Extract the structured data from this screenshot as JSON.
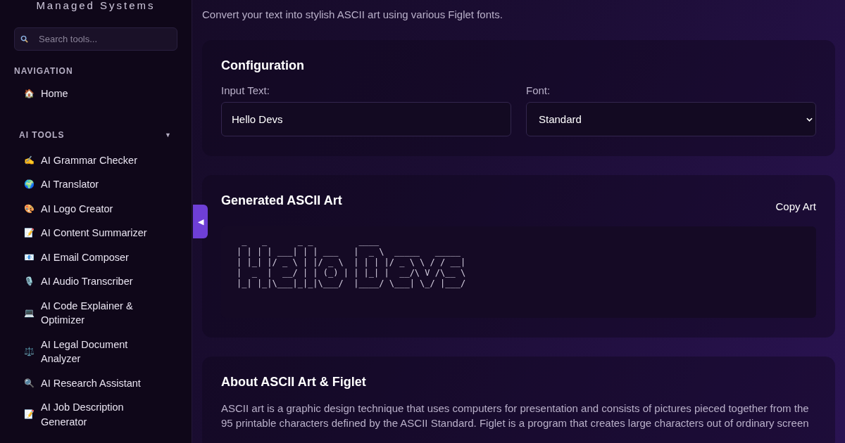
{
  "sidebar": {
    "brand": "Managed Systems",
    "search": {
      "placeholder": "Search tools..."
    },
    "sections": [
      {
        "title": "NAVIGATION",
        "items": [
          {
            "icon": "🏠",
            "label": "Home"
          }
        ]
      },
      {
        "title": "AI TOOLS",
        "caret": "▼",
        "items": [
          {
            "icon": "✍️",
            "label": "AI Grammar Checker"
          },
          {
            "icon": "🌍",
            "label": "AI Translator"
          },
          {
            "icon": "🎨",
            "label": "AI Logo Creator"
          },
          {
            "icon": "📝",
            "label": "AI Content Summarizer"
          },
          {
            "icon": "📧",
            "label": "AI Email Composer"
          },
          {
            "icon": "🎙️",
            "label": "AI Audio Transcriber"
          },
          {
            "icon": "💻",
            "label": "AI Code Explainer & Optimizer"
          },
          {
            "icon": "⚖️",
            "label": "AI Legal Document Analyzer"
          },
          {
            "icon": "🔍",
            "label": "AI Research Assistant"
          },
          {
            "icon": "📝",
            "label": "AI Job Description Generator"
          }
        ]
      }
    ]
  },
  "collapse_toggle": {
    "glyph": "◀"
  },
  "subtitle": "Convert your text into stylish ASCII art using various Figlet fonts.",
  "configuration": {
    "title": "Configuration",
    "input_label": "Input Text:",
    "input_value": "Hello Devs",
    "font_label": "Font:",
    "font_value": "Standard"
  },
  "output": {
    "title": "Generated ASCII Art",
    "copy_button": "Copy Art",
    "ascii_lines": [
      " _   _      _ _         ____",
      "| | | | ___| | | ___   |  _ \\  _____   _____",
      "| |_| |/ _ \\ | |/ _ \\  | | | |/ _ \\ \\ / / __|",
      "|  _  |  __/ | | (_) | | |_| |  __/\\ V /\\__ \\",
      "|_| |_|\\___|_|_|\\___/  |____/ \\___| \\_/ |___/"
    ]
  },
  "about": {
    "title": "About ASCII Art & Figlet",
    "text": "ASCII art is a graphic design technique that uses computers for presentation and consists of pictures pieced together from the 95 printable characters defined by the ASCII Standard. Figlet is a program that creates large characters out of ordinary screen"
  }
}
